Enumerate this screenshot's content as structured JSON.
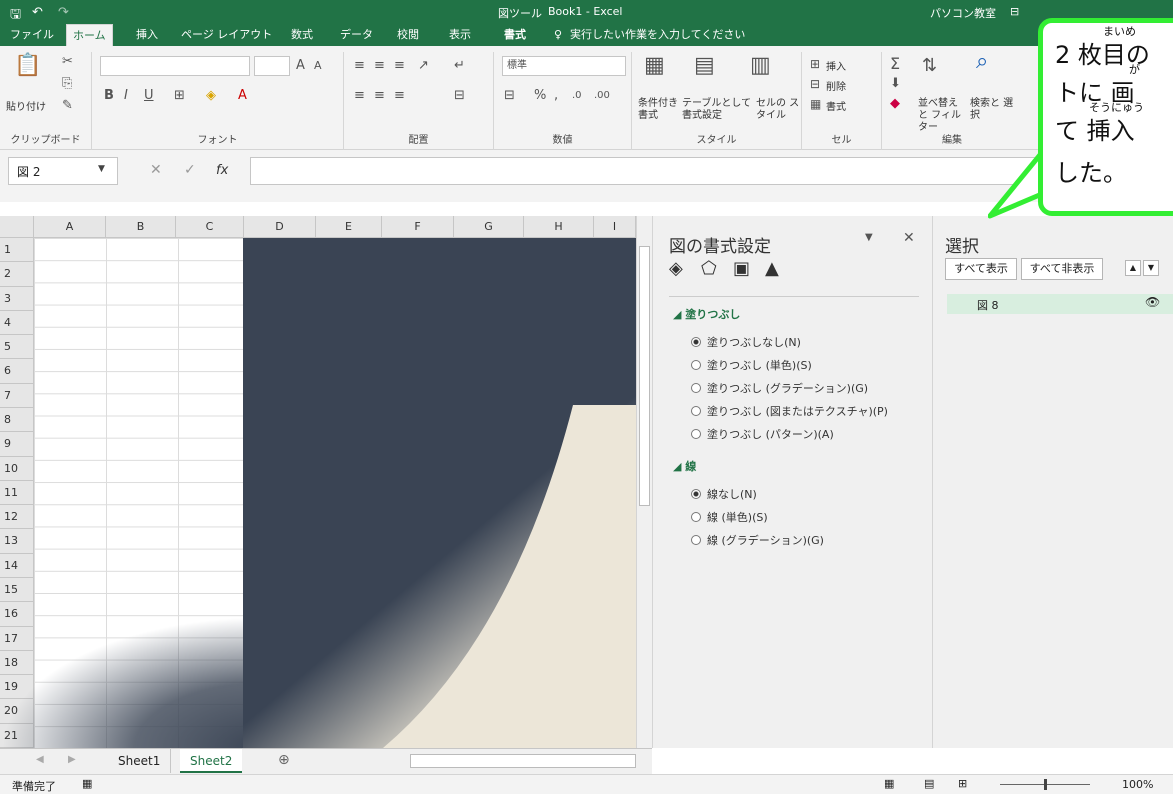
{
  "title": {
    "app": "Book1 - Excel",
    "context_tool": "図ツール",
    "user": "パソコン教室"
  },
  "tabs": [
    "ファイル",
    "ホーム",
    "挿入",
    "ページ レイアウト",
    "数式",
    "データ",
    "校閲",
    "表示",
    "書式"
  ],
  "active_tab": "ホーム",
  "tell_me": "実行したい作業を入力してください",
  "ribbon": {
    "paste": "貼り付け",
    "clipboard": "クリップボード",
    "font": "フォント",
    "alignment": "配置",
    "number_format": "標準",
    "number": "数値",
    "conditional": "条件付き 書式",
    "table": "テーブルとして 書式設定",
    "cellstyle": "セルの スタイル",
    "styles": "スタイル",
    "insert": "挿入",
    "delete": "削除",
    "format": "書式",
    "cells": "セル",
    "sort": "並べ替えと フィルター",
    "find": "検索と 選択",
    "editing": "編集"
  },
  "namebox": "図 2",
  "fx": "fx",
  "columns": [
    "A",
    "B",
    "C",
    "D",
    "E",
    "F",
    "G",
    "H",
    "I"
  ],
  "rows": [
    "1",
    "2",
    "3",
    "4",
    "5",
    "6",
    "7",
    "8",
    "9",
    "10",
    "11",
    "12",
    "13",
    "14",
    "15",
    "16",
    "17",
    "18",
    "19",
    "20",
    "21"
  ],
  "format_pane": {
    "title": "図の書式設定",
    "fill_section": "塗りつぶし",
    "fill_options": [
      "塗りつぶしなし(N)",
      "塗りつぶし (単色)(S)",
      "塗りつぶし (グラデーション)(G)",
      "塗りつぶし (図またはテクスチャ)(P)",
      "塗りつぶし (パターン)(A)"
    ],
    "line_section": "線",
    "line_options": [
      "線なし(N)",
      "線 (単色)(S)",
      "線 (グラデーション)(G)"
    ]
  },
  "selection_pane": {
    "title": "選択",
    "show_all": "すべて表示",
    "hide_all": "すべて非表示",
    "item": "図 8"
  },
  "sheets": [
    "Sheet1",
    "Sheet2"
  ],
  "active_sheet": "Sheet2",
  "status": {
    "ready": "準備完了",
    "zoom": "100%"
  },
  "callout": {
    "line1": "2 枚目の",
    "line2": "トに 画",
    "line3": "て 挿入",
    "line4": "した。",
    "ruby1": "まいめ",
    "ruby2": "が",
    "ruby3": "そうにゅう"
  },
  "colors": {
    "excel_green": "#217346",
    "callout_border": "#33ee33",
    "picture_dark": "#3a4454"
  }
}
